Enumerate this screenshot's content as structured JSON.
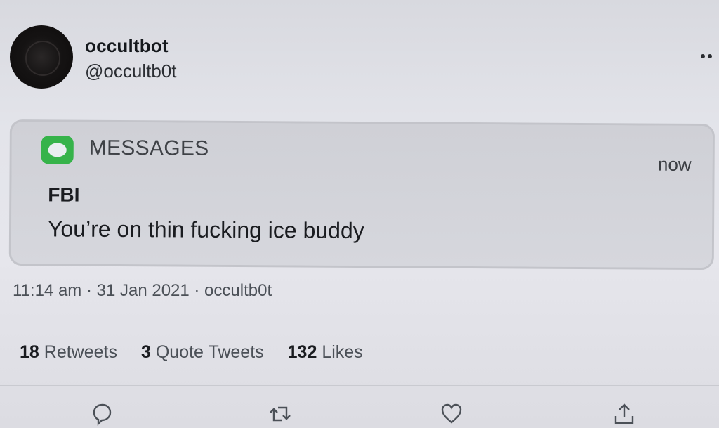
{
  "tweet": {
    "display_name": "occultbot",
    "handle": "@occultb0t",
    "timestamp": "11:14 am · 31 Jan 2021 · occultb0t"
  },
  "notification": {
    "app_name": "MESSAGES",
    "time": "now",
    "sender": "FBI",
    "message": "You’re on thin fucking ice buddy",
    "icon": "messages-app-icon",
    "accent": "#36b34a"
  },
  "stats": {
    "retweets_count": "18",
    "retweets_label": "Retweets",
    "quotes_count": "3",
    "quotes_label": "Quote Tweets",
    "likes_count": "132",
    "likes_label": "Likes"
  },
  "actions": {
    "reply_icon": "reply-icon",
    "retweet_icon": "retweet-icon",
    "like_icon": "heart-icon",
    "share_icon": "share-icon"
  }
}
